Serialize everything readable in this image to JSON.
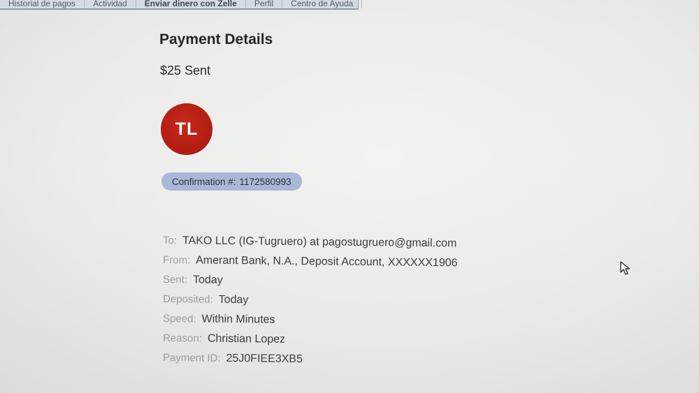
{
  "nav": {
    "tabs": [
      {
        "label": "Historial de pagos"
      },
      {
        "label": "Actividad"
      },
      {
        "label": "Enviar dinero con Zelle"
      },
      {
        "label": "Perfil"
      },
      {
        "label": "Centro de Ayuda"
      }
    ]
  },
  "payment": {
    "title": "Payment Details",
    "amount_text": "$25 Sent",
    "avatar_initials": "TL",
    "avatar_color": "#b01d12",
    "confirmation_label": "Confirmation #:",
    "confirmation_number": "1172580993",
    "pill_color": "#a9b8d6"
  },
  "details": [
    {
      "label": "To:",
      "value": "TAKO LLC (IG-Tugruero) at pagostugruero@gmail.com"
    },
    {
      "label": "From:",
      "value": "Amerant Bank, N.A., Deposit Account, XXXXXX1906"
    },
    {
      "label": "Sent:",
      "value": "Today"
    },
    {
      "label": "Deposited:",
      "value": "Today"
    },
    {
      "label": "Speed:",
      "value": "Within Minutes"
    },
    {
      "label": "Reason:",
      "value": "Christian Lopez"
    },
    {
      "label": "Payment ID:",
      "value": "25J0FIEE3XB5"
    }
  ],
  "cursor_icon": "arrow-cursor-icon"
}
